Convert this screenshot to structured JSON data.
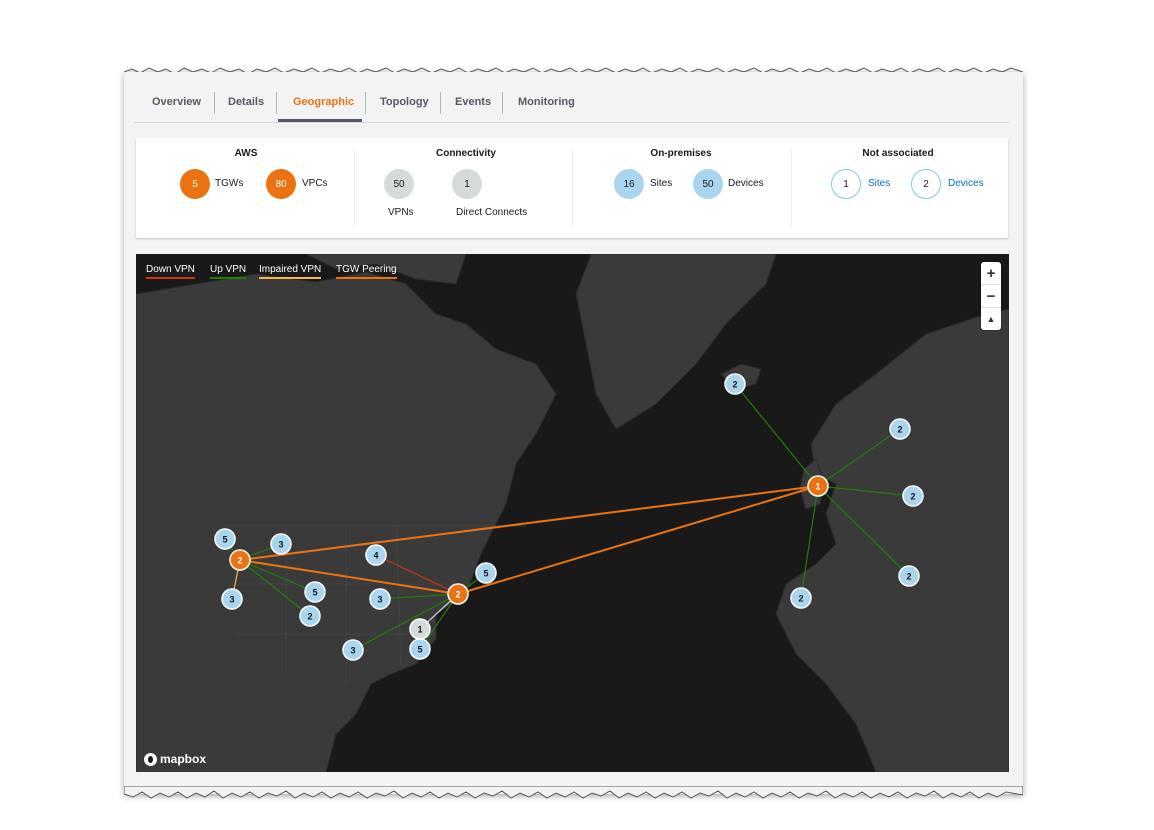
{
  "tabs": [
    "Overview",
    "Details",
    "Geographic",
    "Topology",
    "Events",
    "Monitoring"
  ],
  "summary": {
    "aws": {
      "title": "AWS",
      "tgw_count": "5",
      "tgw_label": "TGWs",
      "vpc_count": "80",
      "vpc_label": "VPCs"
    },
    "connectivity": {
      "title": "Connectivity",
      "vpn_count": "50",
      "vpn_label": "VPNs",
      "dc_count": "1",
      "dc_label": "Direct Connects"
    },
    "onprem": {
      "title": "On-premises",
      "sites_count": "16",
      "sites_label": "Sites",
      "devices_count": "50",
      "devices_label": "Devices"
    },
    "notassoc": {
      "title": "Not associated",
      "sites_count": "1",
      "sites_label": "Sites",
      "devices_count": "2",
      "devices_label": "Devices"
    }
  },
  "legend": [
    {
      "label": "Down VPN",
      "color": "#d13212"
    },
    {
      "label": "Up VPN",
      "color": "#1d8102"
    },
    {
      "label": "Impaired VPN",
      "color": "#f2b84b"
    },
    {
      "label": "TGW Peering",
      "color": "#ec7211"
    }
  ],
  "zoom": {
    "in": "+",
    "out": "−",
    "compass": "▲"
  },
  "attribution": "mapbox",
  "map_markers": [
    {
      "id": "uk",
      "label": "1",
      "type": "tgw"
    },
    {
      "id": "west",
      "label": "2",
      "type": "tgw"
    },
    {
      "id": "east",
      "label": "2",
      "type": "tgw"
    },
    {
      "id": "dc",
      "label": "1",
      "type": "dc"
    },
    {
      "id": "iceland",
      "label": "2",
      "type": "site"
    },
    {
      "id": "scand",
      "label": "2",
      "type": "site"
    },
    {
      "id": "germany",
      "label": "2",
      "type": "site"
    },
    {
      "id": "italy",
      "label": "2",
      "type": "site"
    },
    {
      "id": "iberia",
      "label": "2",
      "type": "site"
    },
    {
      "id": "w5",
      "label": "5",
      "type": "site"
    },
    {
      "id": "w3a",
      "label": "3",
      "type": "site"
    },
    {
      "id": "w3b",
      "label": "3",
      "type": "site"
    },
    {
      "id": "w5b",
      "label": "5",
      "type": "site"
    },
    {
      "id": "w2",
      "label": "2",
      "type": "site"
    },
    {
      "id": "gl4",
      "label": "4",
      "type": "site"
    },
    {
      "id": "c3",
      "label": "3",
      "type": "site"
    },
    {
      "id": "ne5",
      "label": "5",
      "type": "site"
    },
    {
      "id": "tx3",
      "label": "3",
      "type": "site"
    },
    {
      "id": "fl5",
      "label": "5",
      "type": "site"
    }
  ],
  "map_links": [
    {
      "from": "west",
      "to": "uk",
      "status": "peering"
    },
    {
      "from": "west",
      "to": "east",
      "status": "peering"
    },
    {
      "from": "east",
      "to": "uk",
      "status": "peering"
    },
    {
      "from": "uk",
      "to": "iceland",
      "status": "up"
    },
    {
      "from": "uk",
      "to": "scand",
      "status": "up"
    },
    {
      "from": "uk",
      "to": "germany",
      "status": "up"
    },
    {
      "from": "uk",
      "to": "italy",
      "status": "up"
    },
    {
      "from": "uk",
      "to": "iberia",
      "status": "up"
    },
    {
      "from": "west",
      "to": "w5",
      "status": "up"
    },
    {
      "from": "west",
      "to": "w3a",
      "status": "up"
    },
    {
      "from": "west",
      "to": "w3b",
      "status": "impaired"
    },
    {
      "from": "west",
      "to": "w5b",
      "status": "up"
    },
    {
      "from": "west",
      "to": "w2",
      "status": "up"
    },
    {
      "from": "east",
      "to": "gl4",
      "status": "down"
    },
    {
      "from": "east",
      "to": "c3",
      "status": "up"
    },
    {
      "from": "east",
      "to": "ne5",
      "status": "up"
    },
    {
      "from": "east",
      "to": "tx3",
      "status": "up"
    },
    {
      "from": "east",
      "to": "fl5",
      "status": "up"
    },
    {
      "from": "east",
      "to": "dc",
      "status": "dc"
    }
  ]
}
